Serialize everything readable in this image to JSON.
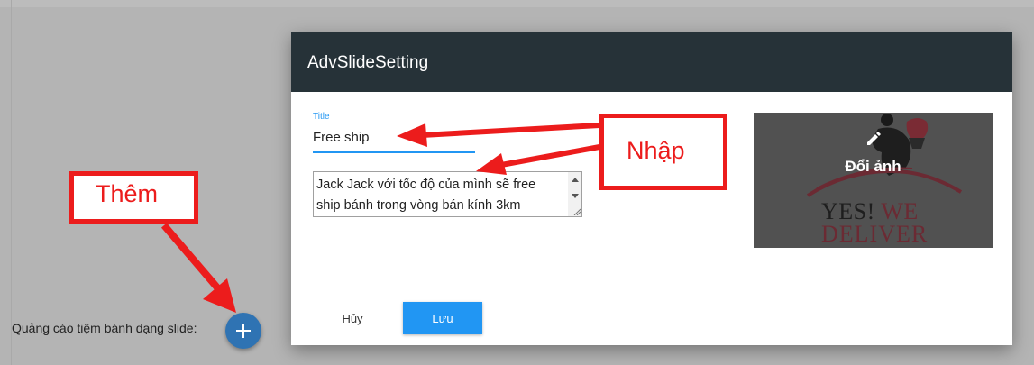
{
  "page": {
    "label": "Quảng cáo tiệm bánh dạng slide:"
  },
  "dialog": {
    "title": "AdvSlideSetting",
    "title_field": {
      "label": "Title",
      "value": "Free ship"
    },
    "description": {
      "line1": "Jack Jack với tốc độ của mình sẽ free",
      "line2": "ship bánh trong vòng bán kính 3km"
    },
    "image": {
      "change_label": "Đổi ảnh",
      "logo_line1_a": "YES!",
      "logo_line1_b": "WE",
      "logo_line2": "DELIVER"
    },
    "buttons": {
      "cancel": "Hủy",
      "save": "Lưu"
    }
  },
  "annotations": {
    "add": "Thêm",
    "input": "Nhập"
  },
  "colors": {
    "header": "#263238",
    "accent": "#2196f3",
    "fab": "#2f73b3",
    "annotation": "#ec1c1c"
  }
}
